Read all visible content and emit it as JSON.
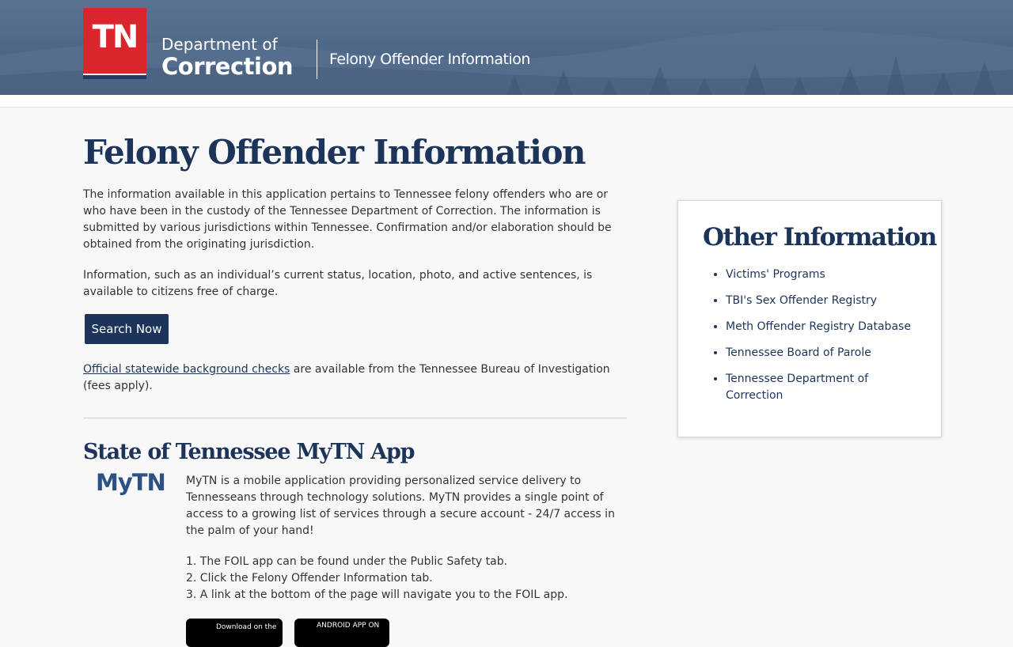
{
  "header": {
    "logo_text": "TN",
    "department_line1": "Department of",
    "department_line2": "Correction",
    "app_title": "Felony Offender Information"
  },
  "main": {
    "title": "Felony Offender Information",
    "intro": "The information available in this application pertains to Tennessee felony offenders who are or who have been in the custody of the Tennessee Department of Correction. The information is submitted by various jurisdictions within Tennessee. Confirmation and/or elaboration should be obtained from the originating jurisdiction.",
    "free_info": "Information, such as an individual’s current status, location, photo, and active sentences, is available to citizens free of charge.",
    "search_button": "Search Now",
    "background_link": "Official statewide background checks",
    "background_text": " are available from the Tennessee Bureau of Investigation (fees apply)."
  },
  "mytn": {
    "heading": "State of Tennessee MyTN App",
    "logo_text": "MyTN",
    "description": "MyTN is a mobile application providing personalized service delivery to Tennesseans through technology solutions. MyTN provides a single point of access to a growing list of services through a secure account - 24/7 access in the palm of your hand!",
    "steps": [
      "1. The FOIL app can be found under the Public Safety tab.",
      "2. Click the Felony Offender Information tab.",
      "3. A link at the bottom of the page will navigate you to the FOIL app."
    ],
    "apple_badge": "Download on the",
    "android_badge": "ANDROID APP ON"
  },
  "sidebar": {
    "title": "Other Information",
    "links": [
      "Victims' Programs",
      "TBI's Sex Offender Registry",
      "Meth Offender Registry Database",
      "Tennessee Board of Parole",
      "Tennessee Department of Correction"
    ]
  },
  "colors": {
    "brand_navy": "#1c3459",
    "brand_red": "#d9262c",
    "header_blue": "#4e6787"
  }
}
